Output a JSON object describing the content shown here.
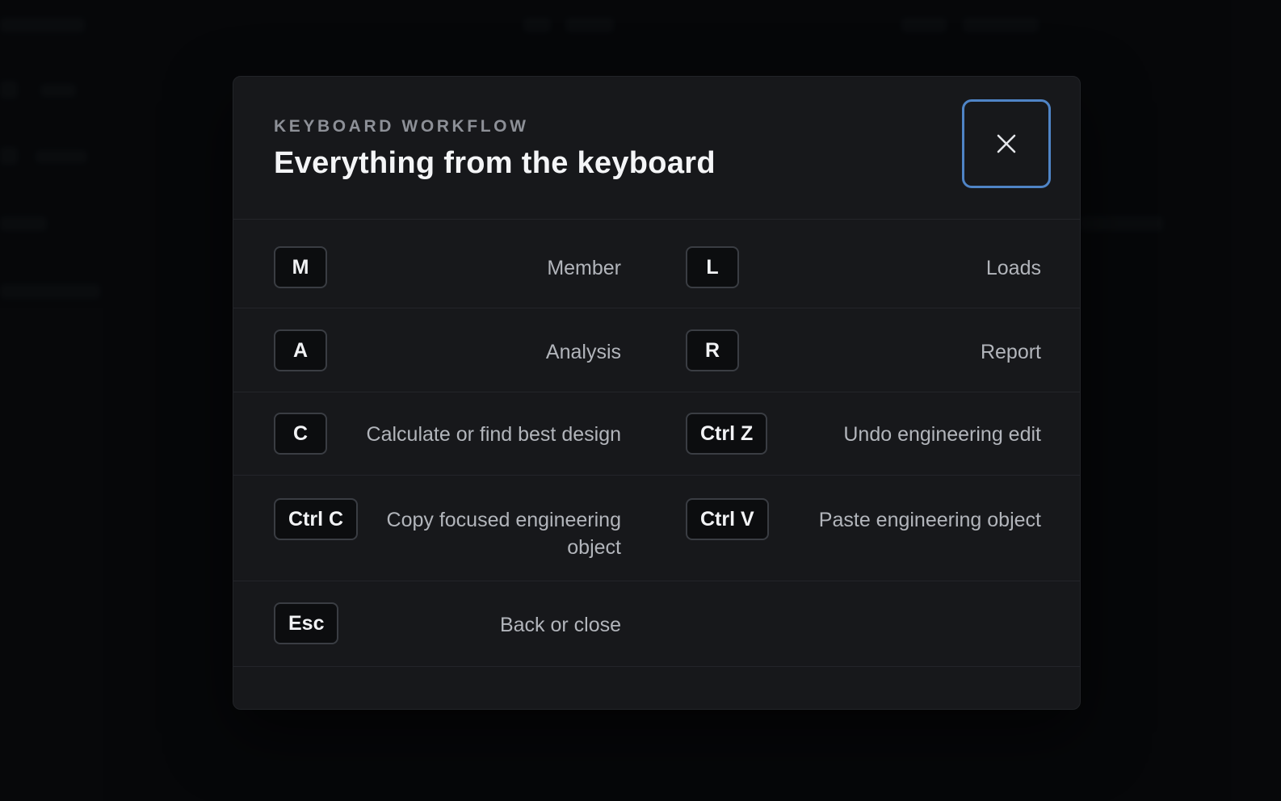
{
  "modal": {
    "eyebrow": "KEYBOARD WORKFLOW",
    "title": "Everything from the keyboard",
    "close_icon": "close-icon"
  },
  "shortcuts": [
    {
      "left": {
        "key": "M",
        "label": "Member"
      },
      "right": {
        "key": "L",
        "label": "Loads"
      }
    },
    {
      "left": {
        "key": "A",
        "label": "Analysis"
      },
      "right": {
        "key": "R",
        "label": "Report"
      }
    },
    {
      "left": {
        "key": "C",
        "label": "Calculate or find best design"
      },
      "right": {
        "key": "Ctrl Z",
        "label": "Undo engineering edit"
      }
    },
    {
      "left": {
        "key": "Ctrl C",
        "label": "Copy focused engineering object"
      },
      "right": {
        "key": "Ctrl V",
        "label": "Paste engineering object"
      }
    },
    {
      "left": {
        "key": "Esc",
        "label": "Back or close"
      }
    }
  ],
  "colors": {
    "accent": "#4f84c6",
    "modal_bg": "#17181b",
    "backdrop": "#0a0b0d"
  }
}
